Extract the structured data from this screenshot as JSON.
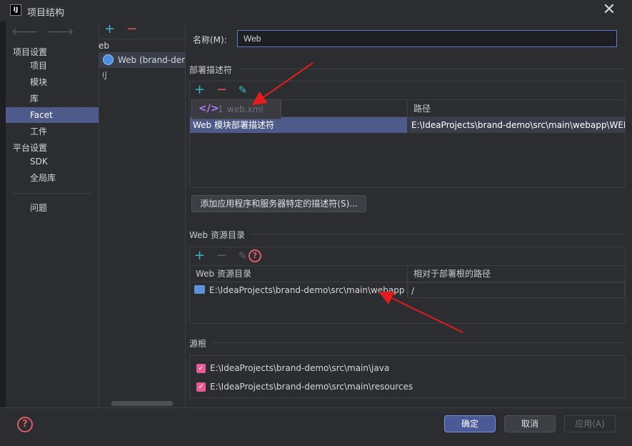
{
  "window": {
    "title": "项目结构",
    "app_icon": "IJ",
    "close_glyph": "✕"
  },
  "nav": {
    "back_glyph": "🡐",
    "forward_glyph": "🡒",
    "section_project_settings": "项目设置",
    "items_project": [
      {
        "label": "项目"
      },
      {
        "label": "模块"
      },
      {
        "label": "库"
      },
      {
        "label": "Facet",
        "selected": true
      },
      {
        "label": "工件"
      }
    ],
    "section_platform_settings": "平台设置",
    "items_platform": [
      {
        "label": "SDK"
      },
      {
        "label": "全局库"
      }
    ],
    "problems": "问题"
  },
  "facets": {
    "add": "+",
    "remove": "−",
    "group_header": "eb",
    "item": "Web (brand-demo)",
    "footer_text": "刂"
  },
  "name": {
    "label": "名称(M):",
    "value": "Web"
  },
  "descriptors": {
    "title": "部署描述符",
    "add": "+",
    "remove": "−",
    "edit": "✎",
    "popup": {
      "number": "1",
      "text": "web.xml",
      "icon": "</>"
    },
    "col_path": "路径",
    "row_type": "Web 模块部署描述符",
    "row_path": "E:\\IdeaProjects\\brand-demo\\src\\main\\webapp\\WEB-INF\\web.xml",
    "add_server_button": "添加应用程序和服务器特定的描述符(S)..."
  },
  "web_resources": {
    "title": "Web 资源目录",
    "add": "+",
    "remove": "−",
    "edit": "✎",
    "help": "?",
    "col_dir": "Web 资源目录",
    "col_relative": "相对于部署根的路径",
    "row_dir": "E:\\IdeaProjects\\brand-demo\\src\\main\\webapp",
    "row_relative": "/"
  },
  "source_roots": {
    "title": "源根",
    "items": [
      {
        "path": "E:\\IdeaProjects\\brand-demo\\src\\main\\java",
        "checked": true
      },
      {
        "path": "E:\\IdeaProjects\\brand-demo\\src\\main\\resources",
        "checked": true
      }
    ],
    "check_glyph": "✓"
  },
  "footer": {
    "help": "?",
    "ok": "确定",
    "cancel": "取消",
    "apply": "应用(A)"
  },
  "colors": {
    "accent": "#4e5b8a",
    "annotation_arrow": "#e11d1d"
  }
}
